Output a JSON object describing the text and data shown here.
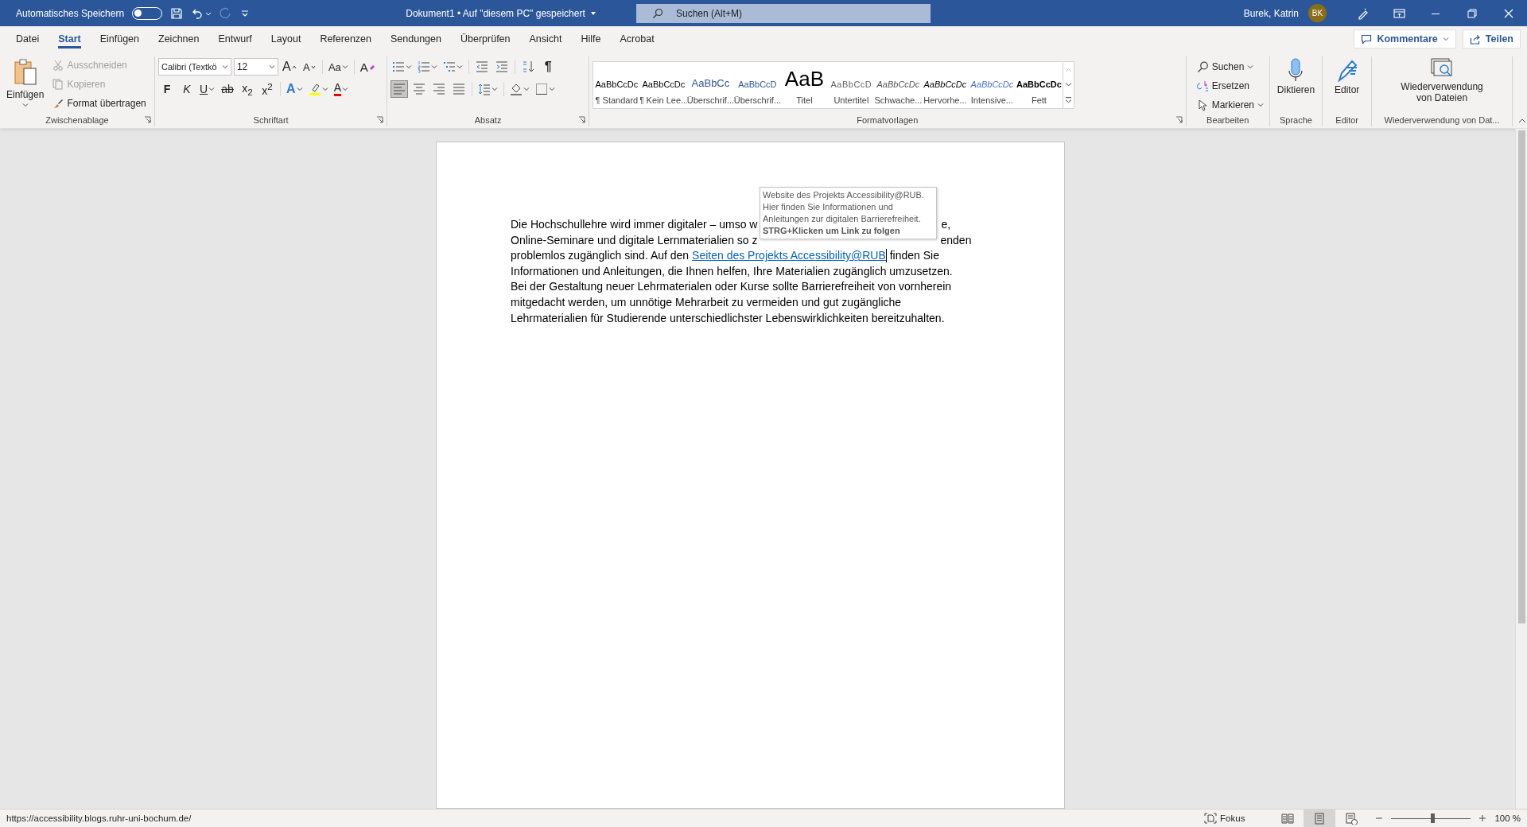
{
  "title_bar": {
    "autosave_label": "Automatisches Speichern",
    "autosave_on": false,
    "document_title": "Dokument1 • Auf \"diesem PC\" gespeichert",
    "search_placeholder": "Suchen (Alt+M)",
    "user_name": "Burek, Katrin",
    "avatar_initials": "BK"
  },
  "menu_tabs": [
    {
      "label": "Datei",
      "selected": false
    },
    {
      "label": "Start",
      "selected": true
    },
    {
      "label": "Einfügen",
      "selected": false
    },
    {
      "label": "Zeichnen",
      "selected": false
    },
    {
      "label": "Entwurf",
      "selected": false
    },
    {
      "label": "Layout",
      "selected": false
    },
    {
      "label": "Referenzen",
      "selected": false
    },
    {
      "label": "Sendungen",
      "selected": false
    },
    {
      "label": "Überprüfen",
      "selected": false
    },
    {
      "label": "Ansicht",
      "selected": false
    },
    {
      "label": "Hilfe",
      "selected": false
    },
    {
      "label": "Acrobat",
      "selected": false
    }
  ],
  "comments_button": "Kommentare",
  "share_button": "Teilen",
  "ribbon": {
    "clipboard": {
      "label": "Zwischenablage",
      "paste": "Einfügen",
      "items": [
        {
          "kind": "cut",
          "label": "Ausschneiden",
          "disabled": true
        },
        {
          "kind": "copy",
          "label": "Kopieren",
          "disabled": true
        },
        {
          "kind": "painter",
          "label": "Format übertragen",
          "disabled": false
        }
      ]
    },
    "font": {
      "label": "Schriftart",
      "font_name": "Calibri (Textkö",
      "font_size": "12",
      "row1": [
        {
          "kind": "grow",
          "label": "A"
        },
        {
          "kind": "shrink",
          "label": "A"
        },
        {
          "kind": "case",
          "label": "Aa"
        },
        {
          "kind": "clear",
          "label": "A"
        }
      ],
      "row2": [
        {
          "kind": "bold",
          "label": "F"
        },
        {
          "kind": "italic",
          "label": "K"
        },
        {
          "kind": "underline",
          "label": "U"
        },
        {
          "kind": "strike",
          "label": "ab"
        },
        {
          "kind": "sub",
          "label": "x$_{2}$"
        },
        {
          "kind": "sup",
          "label": "x$^{2}$"
        },
        {
          "kind": "effects",
          "label": "A"
        },
        {
          "kind": "highlight"
        },
        {
          "kind": "color",
          "label": "A"
        }
      ]
    },
    "paragraph": {
      "label": "Absatz",
      "pilcrow": "¶",
      "alignments": [
        {
          "kind": "left",
          "selected": true
        },
        {
          "kind": "center",
          "selected": false
        },
        {
          "kind": "right",
          "selected": false
        },
        {
          "kind": "justify",
          "selected": false
        }
      ]
    },
    "styles": {
      "label": "Formatvorlagen",
      "items": [
        {
          "kind": "normal",
          "preview": "AaBbCcDc",
          "label": "¶ Standard"
        },
        {
          "kind": "normal",
          "preview": "AaBbCcDc",
          "label": "¶ Kein Lee..."
        },
        {
          "kind": "heading1",
          "preview": "AaBbCc",
          "label": "Überschrif..."
        },
        {
          "kind": "heading2",
          "preview": "AaBbCcD",
          "label": "Überschrif..."
        },
        {
          "kind": "title",
          "preview": "AaB",
          "label": "Titel"
        },
        {
          "kind": "subtitle",
          "preview": "AaBbCcD",
          "label": "Untertitel"
        },
        {
          "kind": "subtle",
          "preview": "AaBbCcDc",
          "label": "Schwache..."
        },
        {
          "kind": "emphasis",
          "preview": "AaBbCcDc",
          "label": "Hervorhe..."
        },
        {
          "kind": "intense",
          "preview": "AaBbCcDc",
          "label": "Intensive..."
        },
        {
          "kind": "strong",
          "preview": "AaBbCcDc",
          "label": "Fett"
        }
      ]
    },
    "editing": {
      "label": "Bearbeiten",
      "items": [
        {
          "kind": "find",
          "label": "Suchen"
        },
        {
          "kind": "replace",
          "label": "Ersetzen"
        },
        {
          "kind": "select",
          "label": "Markieren"
        }
      ]
    },
    "voice": {
      "label": "Sprache",
      "button": "Diktieren"
    },
    "editor": {
      "label": "Editor",
      "button": "Editor"
    },
    "reuse": {
      "label": "Wiederverwendung von Dat...",
      "button": "Wiederverwendung von Dateien"
    }
  },
  "document": {
    "lines": [
      {
        "covered": true,
        "segments": [
          {
            "kind": "text",
            "text": "Die Hochschullehre wird immer digitaler – umso w"
          },
          {
            "kind": "text",
            "text": "e,"
          }
        ]
      },
      {
        "covered": true,
        "segments": [
          {
            "kind": "text",
            "text": "Online-Seminare und digitale Lernmaterialien so z"
          },
          {
            "kind": "text",
            "text": "enden"
          }
        ]
      },
      {
        "segments": [
          {
            "kind": "text",
            "text": "problemlos zugänglich sind. Auf den "
          },
          {
            "kind": "link",
            "text": "Seiten des Projekts Accessibility@RUB"
          },
          {
            "kind": "text",
            "text": " finden Sie"
          }
        ]
      },
      {
        "segments": [
          {
            "kind": "text",
            "text": "Informationen und Anleitungen, die Ihnen helfen, Ihre Materialien zugänglich umzusetzen."
          }
        ]
      },
      {
        "segments": [
          {
            "kind": "text",
            "text": "Bei der Gestaltung neuer Lehrmaterialen oder Kurse sollte Barrierefreiheit von vornherein"
          }
        ]
      },
      {
        "segments": [
          {
            "kind": "text",
            "text": "mitgedacht werden, um unnötige Mehrarbeit zu vermeiden und gut zugängliche"
          }
        ]
      },
      {
        "segments": [
          {
            "kind": "text",
            "text": "Lehrmaterialien für Studierende unterschiedlichster Lebenswirklichkeiten bereitzuhalten."
          }
        ]
      }
    ],
    "tooltip": {
      "description": "Website des Projekts Accessibility@RUB.\nHier finden Sie Informationen und\nAnleitungen zur digitalen Barrierefreiheit.",
      "hint": "STRG+Klicken um Link zu folgen"
    }
  },
  "status_bar": {
    "url": "https://accessibility.blogs.ruhr-uni-bochum.de/",
    "focus": "Fokus",
    "views": [
      {
        "kind": "read",
        "selected": false
      },
      {
        "kind": "print",
        "selected": true
      },
      {
        "kind": "web",
        "selected": false
      }
    ],
    "zoom_slider": {
      "level": 0.5
    },
    "zoom": "100 %"
  }
}
